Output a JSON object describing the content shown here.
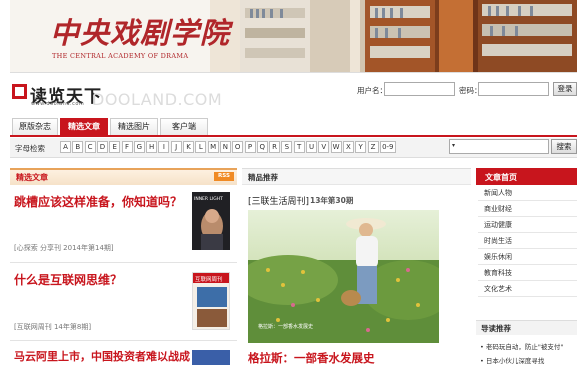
{
  "banner": {
    "logo_text": "中央戏剧学院",
    "subtitle": "THE CENTRAL ACADEMY OF DRAMA"
  },
  "brand": {
    "name": "读览天下",
    "url": "www.dooland.com",
    "watermark": "DOOLAND.COM"
  },
  "login": {
    "username_label": "用户名：",
    "password_label": "密码：",
    "button": "登录"
  },
  "tabs": [
    {
      "label": "原版杂志",
      "active": false
    },
    {
      "label": "精选文章",
      "active": true
    },
    {
      "label": "精选图片",
      "active": false
    },
    {
      "label": "客户端",
      "active": false
    }
  ],
  "letter_index": {
    "label": "字母检索",
    "letters": [
      "A",
      "B",
      "C",
      "D",
      "E",
      "F",
      "G",
      "H",
      "I",
      "J",
      "K",
      "L",
      "M",
      "N",
      "O",
      "P",
      "Q",
      "R",
      "S",
      "T",
      "U",
      "V",
      "W",
      "X",
      "Y",
      "Z",
      "0-9"
    ]
  },
  "search": {
    "caret": "▾",
    "button": "搜索"
  },
  "featured_articles": {
    "header": "精选文章",
    "rss": "RSS",
    "items": [
      {
        "title": "跳槽应该这样准备，你知道吗？",
        "meta": "[心探索 分享刊 2014年第14期]",
        "cover_text": "INNER LIGHT"
      },
      {
        "title": "什么是互联网思维？",
        "meta": "[互联网周刊 14年第8期]",
        "cover_text": "互联网周刊"
      },
      {
        "title": "马云阿里上市，中国投资者难以战成",
        "meta": "",
        "cover_text": ""
      }
    ]
  },
  "recommended": {
    "header": "精品推荐",
    "magazine": "[三联生活周刊]",
    "issue": "13年第30期",
    "caption": "格拉斯：一部香水发展史"
  },
  "sidebar": {
    "header": "文章首页",
    "items": [
      "新闻人物",
      "商业财经",
      "运动健康",
      "时尚生活",
      "娱乐休闲",
      "教育科技",
      "文化艺术"
    ],
    "guide_header": "导读推荐",
    "guide_items": [
      "• 老码玩自动，防止\"被支付\"",
      "• 日本小伙儿深度寻找"
    ]
  },
  "colors": {
    "accent": "#c8151d",
    "rss": "#f08a24"
  }
}
